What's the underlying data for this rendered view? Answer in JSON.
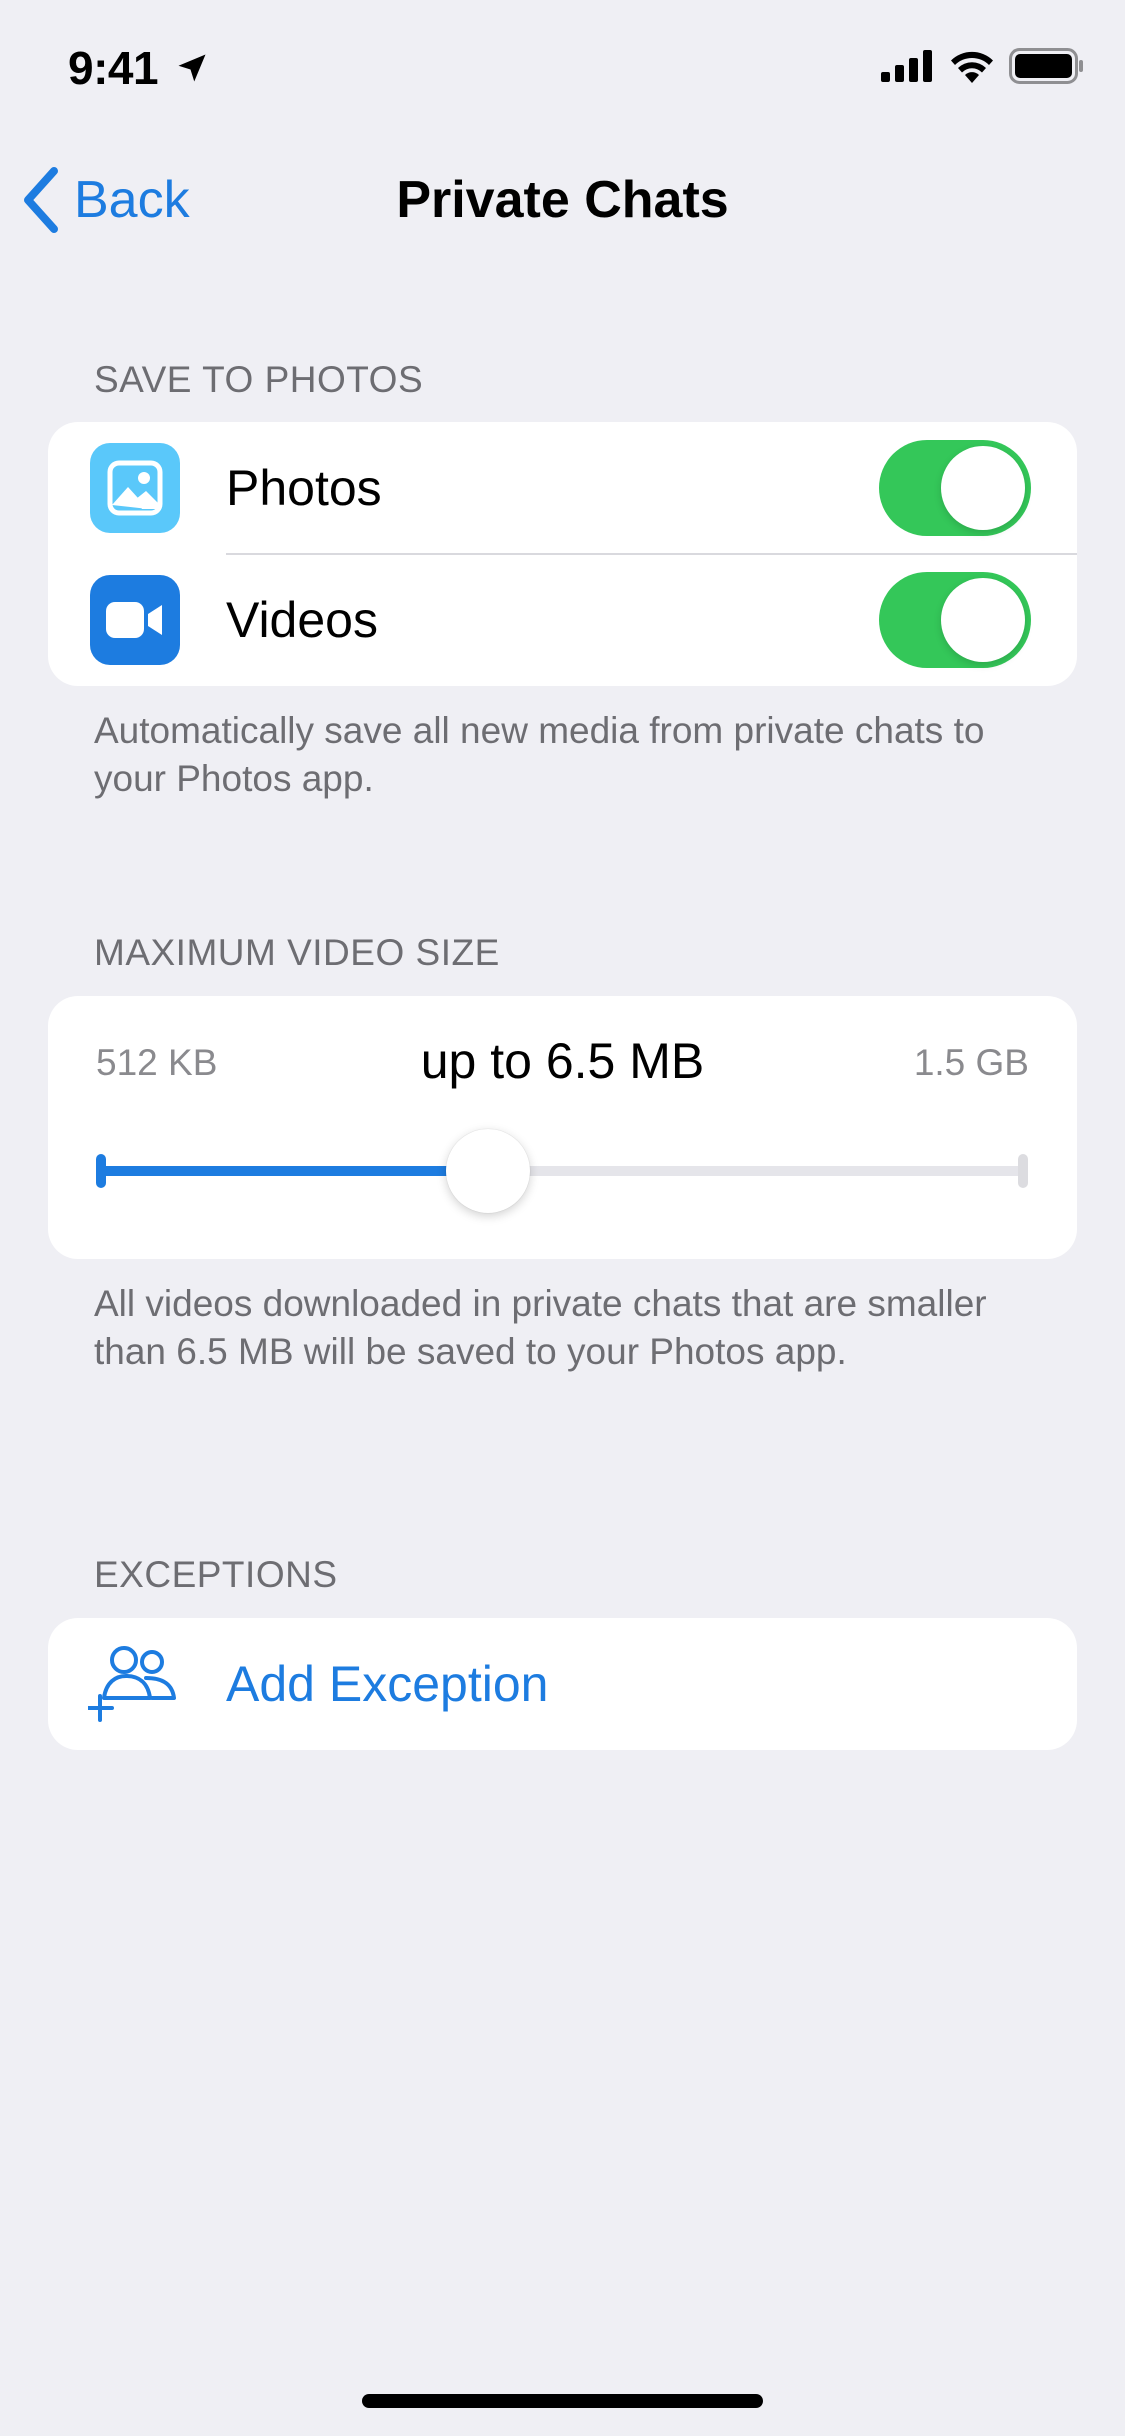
{
  "status_bar": {
    "time": "9:41",
    "location_icon": "location-arrow-icon",
    "signal_icon": "cellular-signal-icon",
    "wifi_icon": "wifi-icon",
    "battery_icon": "battery-icon"
  },
  "nav": {
    "back_label": "Back",
    "title": "Private Chats"
  },
  "save_to_photos": {
    "header": "SAVE TO PHOTOS",
    "items": [
      {
        "label": "Photos",
        "icon": "photo-icon",
        "icon_color": "#5ac8fa",
        "enabled": true
      },
      {
        "label": "Videos",
        "icon": "video-camera-icon",
        "icon_color": "#1d7ce0",
        "enabled": true
      }
    ],
    "footer": "Automatically save all new media from private chats to your Photos app."
  },
  "max_video_size": {
    "header": "MAXIMUM VIDEO SIZE",
    "min_label": "512 KB",
    "max_label": "1.5 GB",
    "value_label": "up to 6.5 MB",
    "slider_fraction": 0.42,
    "footer": "All videos downloaded in private chats that are smaller than 6.5 MB will be saved to your Photos app."
  },
  "exceptions": {
    "header": "EXCEPTIONS",
    "add_label": "Add Exception",
    "add_icon": "add-users-icon"
  },
  "colors": {
    "accent": "#1d7ce0",
    "toggle_on": "#34c759",
    "background": "#efeff4"
  }
}
